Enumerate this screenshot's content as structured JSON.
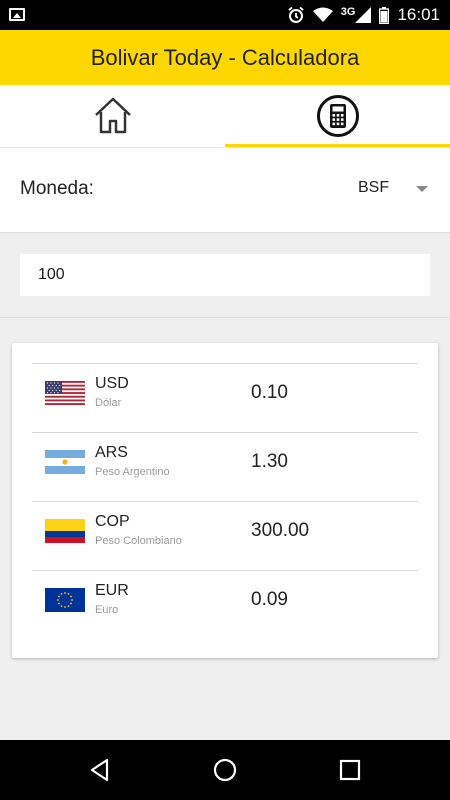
{
  "status_bar": {
    "network": "3G",
    "time": "16:01",
    "icons": [
      "image-icon",
      "alarm-icon",
      "wifi-icon",
      "signal-icon",
      "battery-icon"
    ]
  },
  "app_bar": {
    "title": "Bolivar Today - Calculadora"
  },
  "tabs": [
    {
      "icon": "home-icon",
      "active": false
    },
    {
      "icon": "calculator-icon",
      "active": true
    }
  ],
  "currency_selector": {
    "label": "Moneda:",
    "selected": "BSF"
  },
  "amount_input": {
    "value": "100"
  },
  "conversions": [
    {
      "code": "USD",
      "name": "Dólar",
      "value": "0.10",
      "flag": "us-flag-icon"
    },
    {
      "code": "ARS",
      "name": "Peso Argentino",
      "value": "1.30",
      "flag": "argentina-flag-icon"
    },
    {
      "code": "COP",
      "name": "Peso Colombiano",
      "value": "300.00",
      "flag": "colombia-flag-icon"
    },
    {
      "code": "EUR",
      "name": "Euro",
      "value": "0.09",
      "flag": "eu-flag-icon"
    }
  ],
  "colors": {
    "accent": "#ffd700",
    "background": "#efefef"
  },
  "nav_bar": {
    "buttons": [
      "back-icon",
      "home-circle-icon",
      "recents-icon"
    ]
  }
}
